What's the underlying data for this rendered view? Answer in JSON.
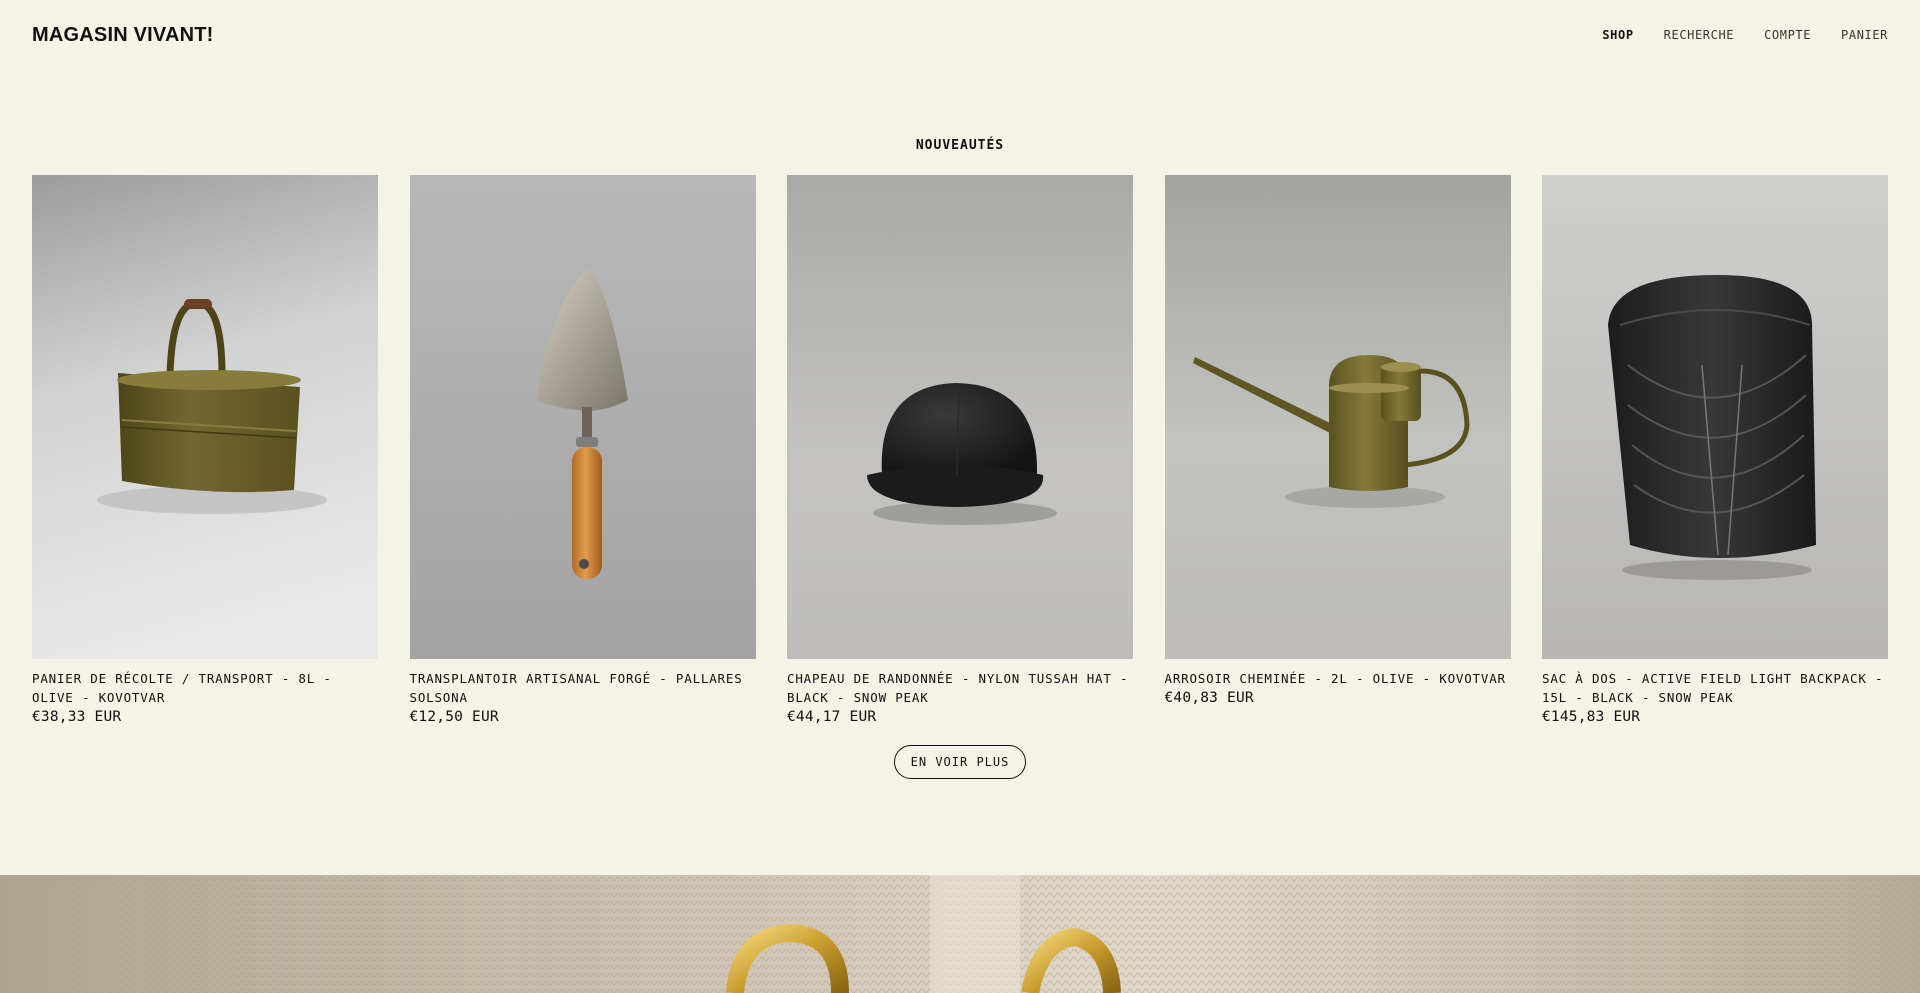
{
  "header": {
    "logo": "MAGASIN VIVANT!",
    "nav": [
      {
        "label": "SHOP",
        "active": true
      },
      {
        "label": "RECHERCHE",
        "active": false
      },
      {
        "label": "COMPTE",
        "active": false
      },
      {
        "label": "PANIER",
        "active": false
      }
    ]
  },
  "section": {
    "title": "NOUVEAUTÉS",
    "more_label": "EN VOIR PLUS"
  },
  "products": [
    {
      "title": "PANIER DE RÉCOLTE / TRANSPORT - 8L - OLIVE - KOVOTVAR",
      "price": "€38,33 EUR",
      "image": "olive-harvest-basket"
    },
    {
      "title": "TRANSPLANTOIR ARTISANAL FORGÉ - PALLARES SOLSONA",
      "price": "€12,50 EUR",
      "image": "forged-trowel"
    },
    {
      "title": "CHAPEAU DE RANDONNÉE - NYLON TUSSAH HAT - BLACK - SNOW PEAK",
      "price": "€44,17 EUR",
      "image": "black-bucket-hat"
    },
    {
      "title": "ARROSOIR CHEMINÉE - 2L - OLIVE - KOVOTVAR",
      "price": "€40,83 EUR",
      "image": "olive-watering-can"
    },
    {
      "title": "SAC À DOS - ACTIVE FIELD LIGHT BACKPACK - 15L - BLACK - SNOW PEAK",
      "price": "€145,83 EUR",
      "image": "black-backpack"
    }
  ],
  "banner": {
    "image": "knit-with-gold-buckles"
  },
  "colors": {
    "background": "#f5f2e6",
    "text": "#111111",
    "olive": "#6b6128"
  }
}
